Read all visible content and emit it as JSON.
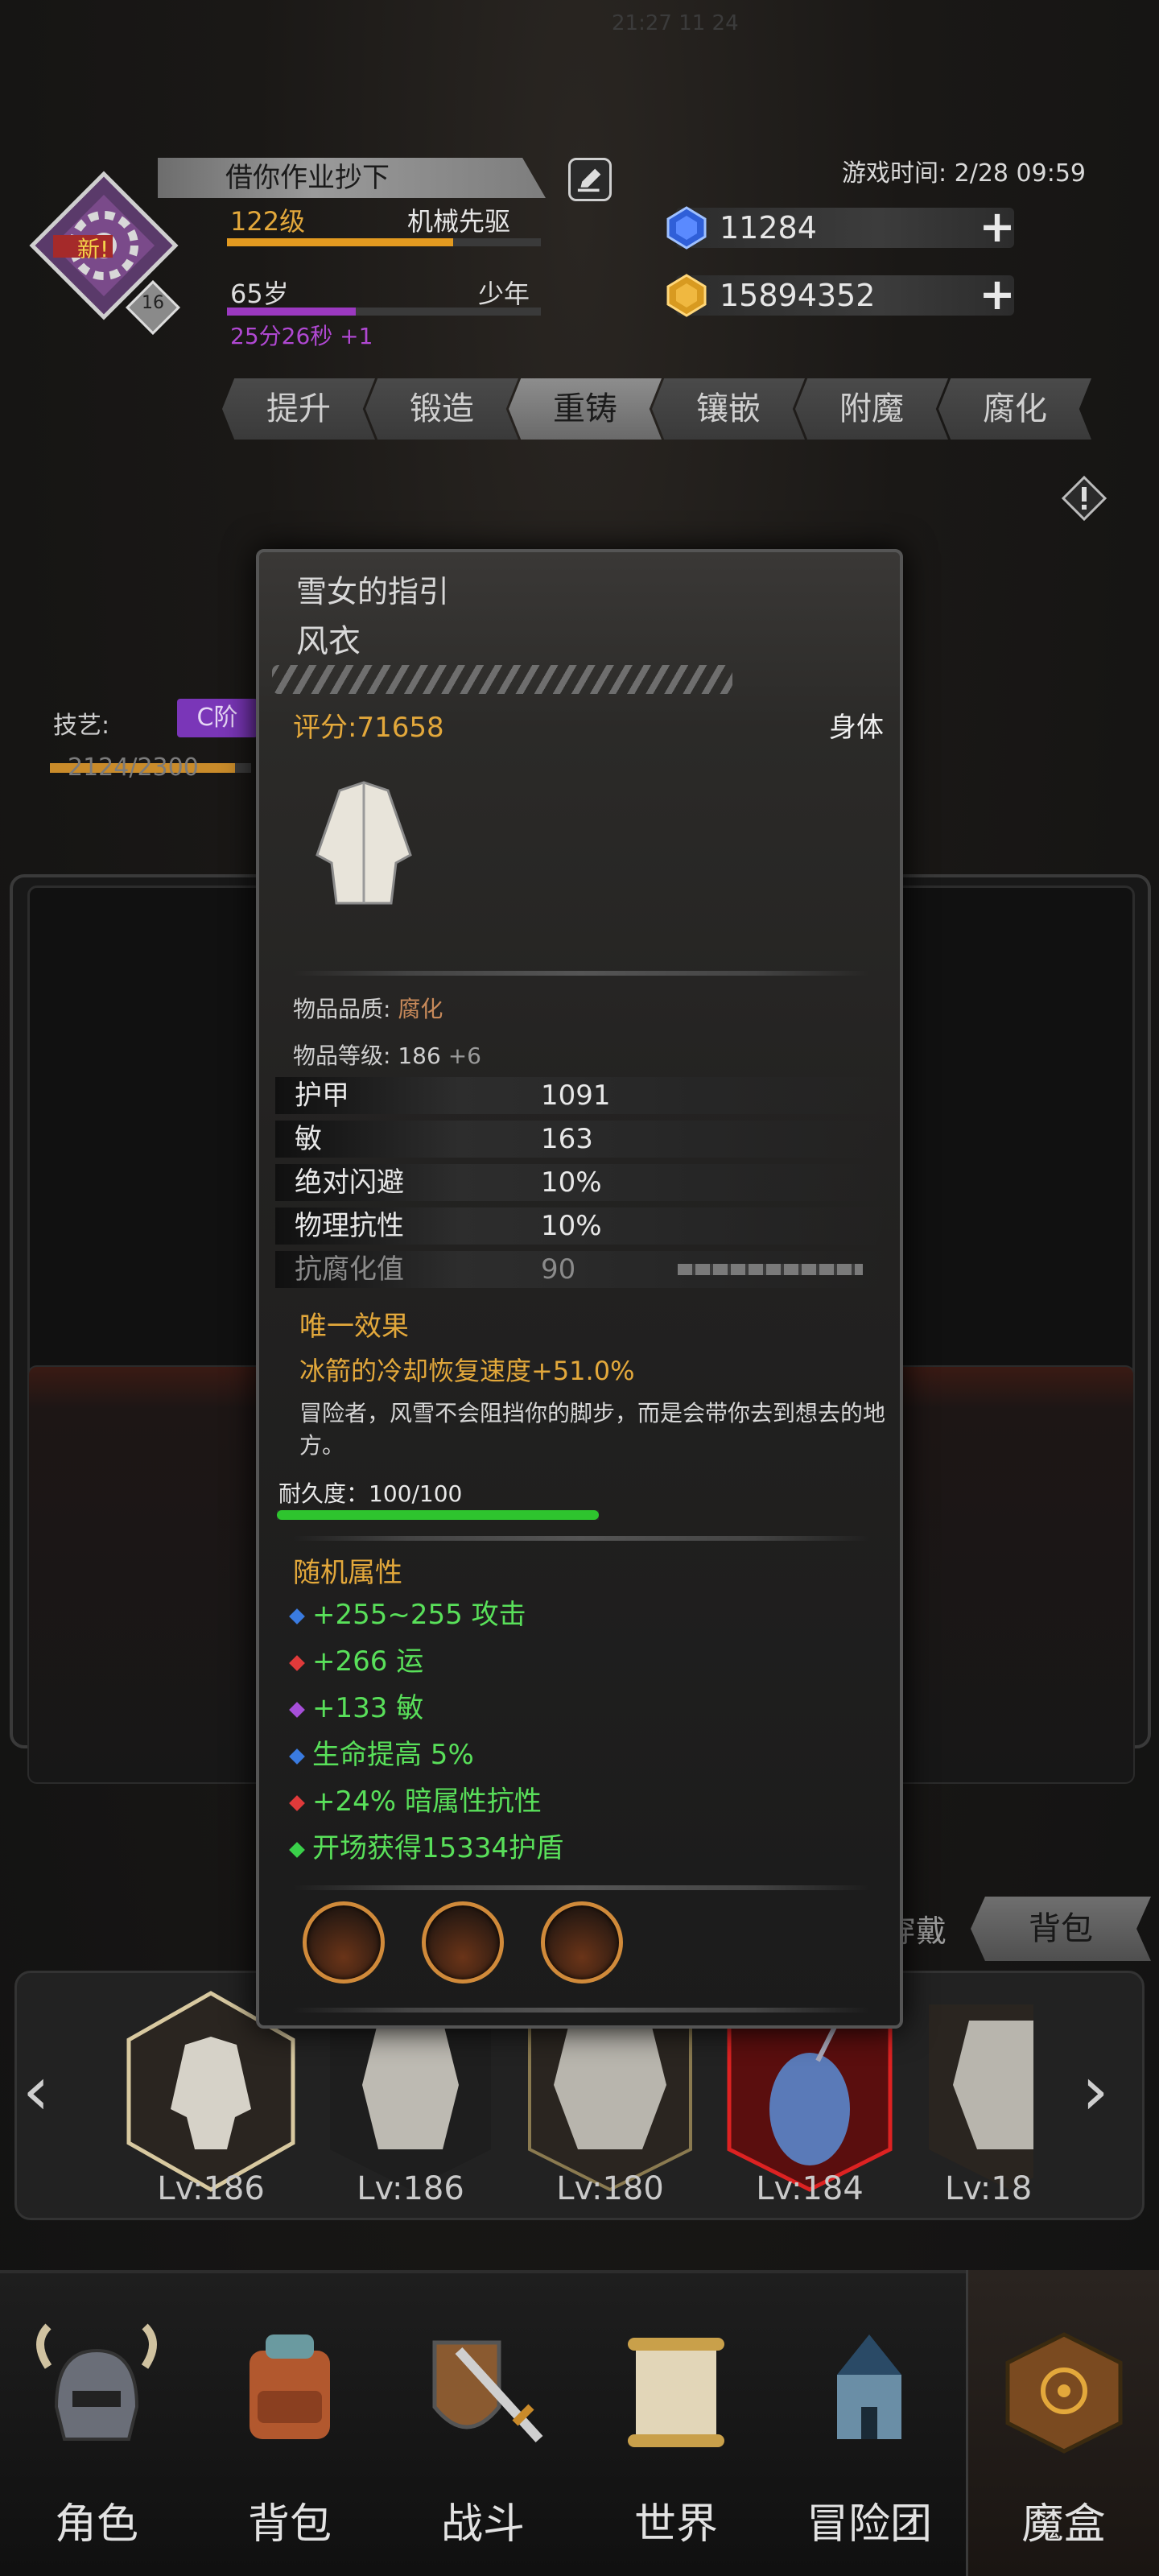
{
  "status_bar": {
    "time": "21:27 11 24"
  },
  "player": {
    "name": "借你作业抄下",
    "new_badge": "新!",
    "avatar_level": "16",
    "level": "122级",
    "job": "机械先驱",
    "level_progress": 0.72,
    "age": "65岁",
    "stage": "少年",
    "age_progress": 0.41,
    "age_timer": "25分26秒 +1"
  },
  "game_time": "游戏时间: 2/28 09:59",
  "resources": {
    "gem": "11284",
    "gold": "15894352"
  },
  "tabs": [
    "提升",
    "锻造",
    "重铸",
    "镶嵌",
    "附魔",
    "腐化"
  ],
  "active_tab": "重铸",
  "skill": {
    "label": "技艺:",
    "tier": "C阶",
    "progress_text": "2124/2300",
    "progress": 0.92
  },
  "inventory_tabs": {
    "wear": "穿戴",
    "pack": "背包"
  },
  "carousel": {
    "items": [
      {
        "level": "Lv:186"
      },
      {
        "level": "Lv:186"
      },
      {
        "level": "Lv:180"
      },
      {
        "level": "Lv:184"
      },
      {
        "level": "Lv:18"
      }
    ]
  },
  "nav": [
    {
      "label": "角色",
      "icon": "helmet-icon"
    },
    {
      "label": "背包",
      "icon": "backpack-icon"
    },
    {
      "label": "战斗",
      "icon": "shield-sword-icon"
    },
    {
      "label": "世界",
      "icon": "scroll-icon"
    },
    {
      "label": "冒险团",
      "icon": "castle-icon"
    },
    {
      "label": "魔盒",
      "icon": "magic-box-icon"
    }
  ],
  "item": {
    "name": "雪女的指引",
    "type": "风衣",
    "score": "评分:71658",
    "slot": "身体",
    "quality_label": "物品品质:",
    "quality_value": "腐化",
    "level_label": "物品等级:",
    "level_value": "186",
    "level_bonus": "+6",
    "stats": [
      {
        "k": "护甲",
        "v": "1091"
      },
      {
        "k": "敏",
        "v": "163"
      },
      {
        "k": "绝对闪避",
        "v": "10%"
      },
      {
        "k": "物理抗性",
        "v": "10%"
      },
      {
        "k": "抗腐化值",
        "v": "90"
      }
    ],
    "unique_title": "唯一效果",
    "unique_effect": "冰箭的冷却恢复速度+51.0%",
    "flavor": "冒险者，风雪不会阻挡你的脚步，而是会带你去到想去的地方。",
    "durability": "耐久度：100/100",
    "durability_progress": 1.0,
    "random_title": "随机属性",
    "affixes": [
      {
        "text": "+255~255 攻击",
        "dot": "#3a7be0"
      },
      {
        "text": "+266 运",
        "dot": "#e03a3a"
      },
      {
        "text": "+133 敏",
        "dot": "#a64fd8"
      },
      {
        "text": "生命提高 5%",
        "dot": "#3a7be0"
      },
      {
        "text": "+24% 暗属性抗性",
        "dot": "#e03a3a"
      },
      {
        "text": "开场获得15334护盾",
        "dot": "#3ad04a"
      }
    ]
  },
  "colors": {
    "accent": "#e3a83b",
    "affix_text": "#59e05a",
    "durability": "#2ec42e"
  }
}
